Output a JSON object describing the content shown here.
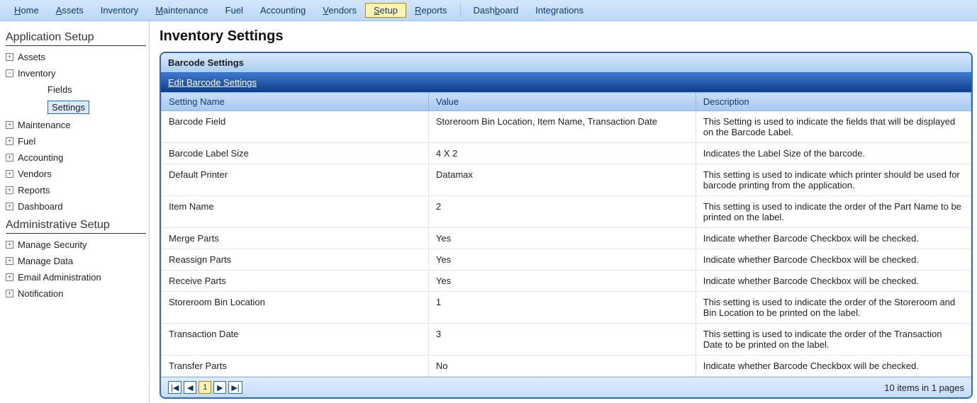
{
  "menu": {
    "items": [
      "Home",
      "Assets",
      "Inventory",
      "Maintenance",
      "Fuel",
      "Accounting",
      "Vendors",
      "Setup",
      "Reports",
      "Dashboard",
      "Integrations"
    ],
    "selected": "Setup"
  },
  "sidebar": {
    "app_setup": "Application Setup",
    "admin_setup": "Administrative Setup",
    "app_items": [
      {
        "label": "Assets",
        "expand": "plus"
      },
      {
        "label": "Inventory",
        "expand": "minus",
        "children": [
          {
            "label": "Fields"
          },
          {
            "label": "Settings",
            "selected": true
          }
        ]
      },
      {
        "label": "Maintenance",
        "expand": "plus"
      },
      {
        "label": "Fuel",
        "expand": "plus"
      },
      {
        "label": "Accounting",
        "expand": "plus"
      },
      {
        "label": "Vendors",
        "expand": "plus"
      },
      {
        "label": "Reports",
        "expand": "plus"
      },
      {
        "label": "Dashboard",
        "expand": "plus"
      }
    ],
    "admin_items": [
      {
        "label": "Manage Security",
        "expand": "plus"
      },
      {
        "label": "Manage Data",
        "expand": "plus"
      },
      {
        "label": "Email Administration",
        "expand": "plus"
      },
      {
        "label": "Notification",
        "expand": "plus"
      }
    ]
  },
  "page": {
    "title": "Inventory Settings"
  },
  "panel": {
    "title": "Barcode Settings",
    "edit_link": "Edit Barcode Settings",
    "columns": [
      "Setting Name",
      "Value",
      "Description"
    ],
    "rows": [
      {
        "name": "Barcode Field",
        "value": "Storeroom Bin Location, Item Name, Transaction Date",
        "desc": "This Setting is used to indicate the fields that will be displayed on the Barcode Label."
      },
      {
        "name": "Barcode Label Size",
        "value": "4 X 2",
        "desc": "Indicates the Label Size of the barcode."
      },
      {
        "name": "Default Printer",
        "value": "Datamax",
        "desc": "This setting is used to indicate which printer should be used for barcode printing from the application."
      },
      {
        "name": "Item Name",
        "value": "2",
        "desc": "This setting is used to indicate the order of the Part Name to be printed on the label."
      },
      {
        "name": "Merge Parts",
        "value": "Yes",
        "desc": "Indicate whether Barcode Checkbox will be checked."
      },
      {
        "name": "Reassign Parts",
        "value": "Yes",
        "desc": "Indicate whether Barcode Checkbox will be checked."
      },
      {
        "name": "Receive Parts",
        "value": "Yes",
        "desc": "Indicate whether Barcode Checkbox will be checked."
      },
      {
        "name": "Storeroom Bin Location",
        "value": "1",
        "desc": "This setting is used to indicate the order of the Storeroom and Bin Location to be printed on the label."
      },
      {
        "name": "Transaction Date",
        "value": "3",
        "desc": "This setting is used to indicate the order of the Transaction Date to be printed on the label."
      },
      {
        "name": "Transfer Parts",
        "value": "No",
        "desc": "Indicate whether Barcode Checkbox will be checked."
      }
    ],
    "pager": {
      "first": "|◀",
      "prev": "◀",
      "page": "1",
      "next": "▶",
      "last": "▶|",
      "summary": "10 items in 1 pages"
    }
  }
}
